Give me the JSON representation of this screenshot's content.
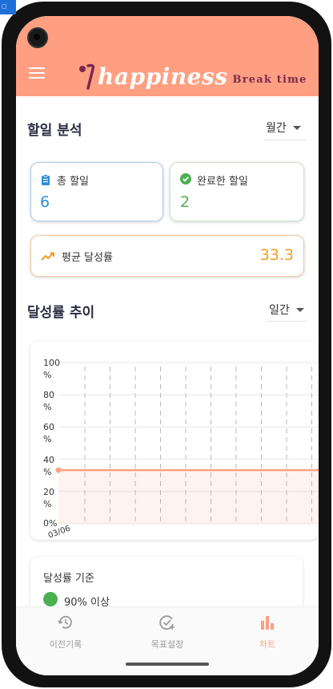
{
  "app": {
    "title": "happiness",
    "subtitle": "Break time"
  },
  "analysis": {
    "title": "할일 분석",
    "period": "월간"
  },
  "stats": {
    "total_label": "총 할일",
    "total_value": "6",
    "done_label": "완료한 할일",
    "done_value": "2",
    "avg_label": "평균 달성률",
    "avg_value": "33.3"
  },
  "trend": {
    "title": "달성률 추이",
    "period": "일간"
  },
  "chart_data": {
    "type": "area",
    "x": [
      "03/06"
    ],
    "series": [
      {
        "values": [
          33.3
        ]
      }
    ],
    "yticks": [
      "100\n%",
      "80\n%",
      "60\n%",
      "40\n%",
      "20\n%",
      "0%"
    ],
    "ylim": [
      0,
      100
    ],
    "grid": true,
    "color": "#ff9f82"
  },
  "criteria": {
    "title": "달성률 기준",
    "items": [
      {
        "label": "90% 이상",
        "color": "#4caf50"
      }
    ]
  },
  "nav": {
    "items": [
      {
        "label": "이전기록",
        "icon": "history-icon"
      },
      {
        "label": "목표설정",
        "icon": "goal-check-icon"
      },
      {
        "label": "차트",
        "icon": "bar-chart-icon"
      }
    ]
  },
  "colors": {
    "accent": "#ff9f82",
    "blue": "#2f8ed6",
    "green": "#4caf50",
    "orange": "#f59c22"
  }
}
